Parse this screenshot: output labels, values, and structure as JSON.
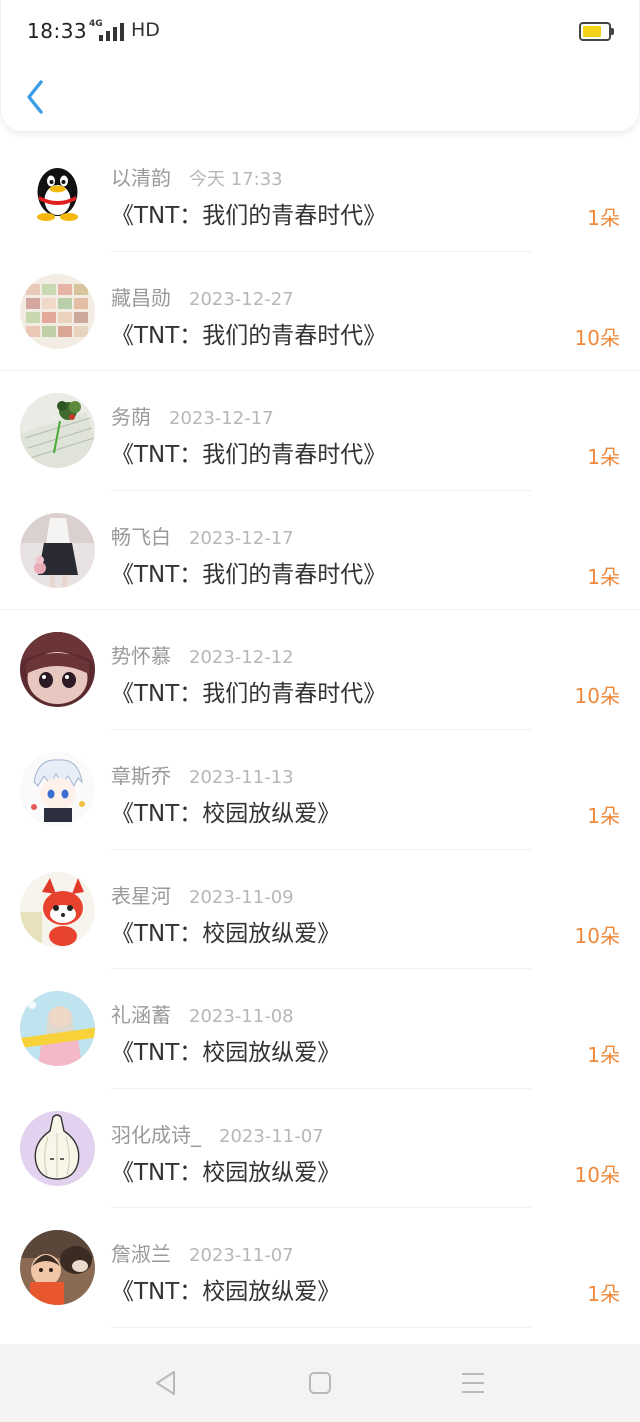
{
  "status_bar": {
    "time": "18:33",
    "network": "4G",
    "hd": "HD",
    "battery_level": 0.75,
    "battery_color": "#f3d219"
  },
  "nav": {
    "back_icon": "chevron-left-icon",
    "accent": "#3a9de5"
  },
  "records": [
    {
      "name": "以清韵",
      "date": "今天 17:33",
      "title": "《TNT：我们的青春时代》",
      "count": "1朵"
    },
    {
      "name": "藏昌勋",
      "date": "2023-12-27",
      "title": "《TNT：我们的青春时代》",
      "count": "10朵"
    },
    {
      "name": "务荫",
      "date": "2023-12-17",
      "title": "《TNT：我们的青春时代》",
      "count": "1朵"
    },
    {
      "name": "畅飞白",
      "date": "2023-12-17",
      "title": "《TNT：我们的青春时代》",
      "count": "1朵"
    },
    {
      "name": "势怀慕",
      "date": "2023-12-12",
      "title": "《TNT：我们的青春时代》",
      "count": "10朵"
    },
    {
      "name": "章斯乔",
      "date": "2023-11-13",
      "title": "《TNT：校园放纵爱》",
      "count": "1朵"
    },
    {
      "name": "表星河",
      "date": "2023-11-09",
      "title": "《TNT：校园放纵爱》",
      "count": "10朵"
    },
    {
      "name": "礼涵蓄",
      "date": "2023-11-08",
      "title": "《TNT：校园放纵爱》",
      "count": "1朵"
    },
    {
      "name": "羽化成诗_",
      "date": "2023-11-07",
      "title": "《TNT：校园放纵爱》",
      "count": "10朵"
    },
    {
      "name": "詹淑兰",
      "date": "2023-11-07",
      "title": "《TNT：校园放纵爱》",
      "count": "1朵"
    }
  ],
  "colors": {
    "count_orange": "#ef8a3d",
    "name_gray": "#9a9a9a",
    "date_gray": "#b7b7b7",
    "title_dark": "#333333"
  },
  "system_nav": {
    "back_icon": "triangle-back-icon",
    "home_icon": "square-home-icon",
    "menu_icon": "hamburger-menu-icon"
  }
}
